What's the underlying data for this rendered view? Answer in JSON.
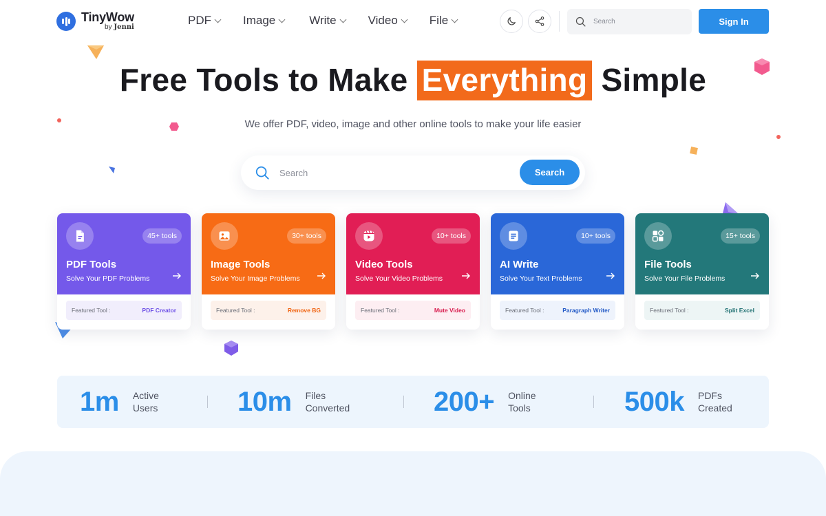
{
  "header": {
    "logo_title": "TinyWow",
    "logo_sub_prefix": "by",
    "logo_sub_brand": "Jenni",
    "nav": [
      {
        "label": "PDF"
      },
      {
        "label": "Image"
      },
      {
        "label": "Write"
      },
      {
        "label": "Video"
      },
      {
        "label": "File"
      }
    ],
    "search_placeholder": "Search",
    "signin_label": "Sign In"
  },
  "hero": {
    "title_before": "Free Tools to Make",
    "title_highlight": "Everything",
    "title_after": "Simple",
    "subtitle": "We offer PDF, video, image and other online tools to make your life easier",
    "search_placeholder": "Search",
    "search_button": "Search"
  },
  "cards": [
    {
      "title": "PDF Tools",
      "desc": "Solve Your PDF Problems",
      "badge": "45+ tools",
      "featured_label": "Featured Tool :",
      "featured_value": "PDF Creator",
      "icon": "pdf-file-icon",
      "color": "#7459ea",
      "accent": "#6c4ee6",
      "feat_bg": "#f1eefc"
    },
    {
      "title": "Image Tools",
      "desc": "Solve Your Image Problems",
      "badge": "30+ tools",
      "featured_label": "Featured Tool :",
      "featured_value": "Remove BG",
      "icon": "image-icon",
      "color": "#f76b15",
      "accent": "#f0620e",
      "feat_bg": "#fdf1ea"
    },
    {
      "title": "Video Tools",
      "desc": "Solve Your Video Problems",
      "badge": "10+ tools",
      "featured_label": "Featured Tool :",
      "featured_value": "Mute Video",
      "icon": "video-icon",
      "color": "#e11e55",
      "accent": "#d81b4d",
      "feat_bg": "#fdeef2"
    },
    {
      "title": "AI Write",
      "desc": "Solve Your Text Problems",
      "badge": "10+ tools",
      "featured_label": "Featured Tool :",
      "featured_value": "Paragraph Writer",
      "icon": "document-text-icon",
      "color": "#2a67d8",
      "accent": "#2259c6",
      "feat_bg": "#eef3fc"
    },
    {
      "title": "File Tools",
      "desc": "Solve Your File Problems",
      "badge": "15+ tools",
      "featured_label": "Featured Tool :",
      "featured_value": "Split Excel",
      "icon": "file-grid-icon",
      "color": "#23787a",
      "accent": "#1d6e70",
      "feat_bg": "#edf5f5"
    }
  ],
  "stats": [
    {
      "value": "1m",
      "label_line1": "Active",
      "label_line2": "Users"
    },
    {
      "value": "10m",
      "label_line1": "Files",
      "label_line2": "Converted"
    },
    {
      "value": "200+",
      "label_line1": "Online",
      "label_line2": "Tools"
    },
    {
      "value": "500k",
      "label_line1": "PDFs",
      "label_line2": "Created"
    }
  ],
  "colors": {
    "primary": "#2b8ee8",
    "highlight": "#f26a1b",
    "stats_bg": "#edf5fd"
  }
}
